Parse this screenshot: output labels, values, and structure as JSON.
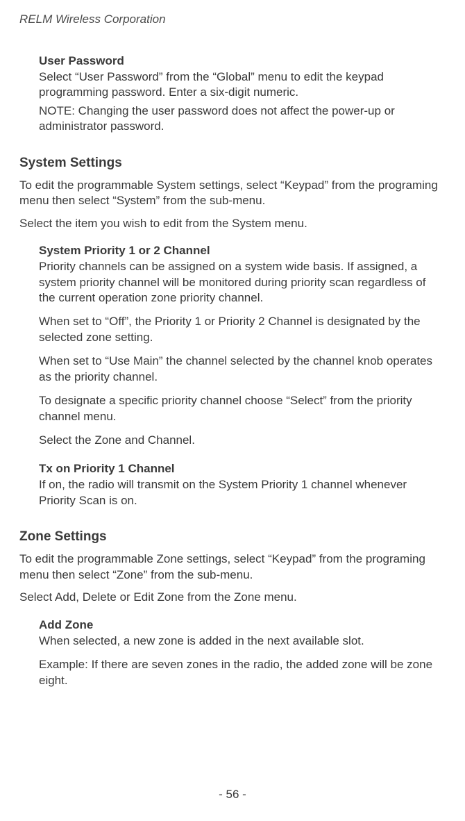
{
  "header": {
    "company": "RELM Wireless Corporation"
  },
  "user_password": {
    "heading": "User Password",
    "p1": "Select “User Password” from the “Global” menu to edit the keypad programming password. Enter a six-digit numeric.",
    "p2": "NOTE: Changing the user password does not affect the power-up or administrator password."
  },
  "system_settings": {
    "heading": "System Settings",
    "intro1": "To edit the programmable System settings, select “Keypad” from the programing menu then select “System” from the sub-menu.",
    "intro2": "Select the item you wish to edit from the System menu.",
    "priority": {
      "heading": "System Priority 1 or 2 Channel",
      "p1": "Priority channels can be assigned on a system wide basis. If assigned, a system priority channel will be monitored during priority scan regardless of the current operation zone priority channel.",
      "p2": "When set to “Off”, the Priority 1 or Priority 2 Channel is designated by the selected zone setting.",
      "p3": "When set to “Use Main” the channel selected by the channel knob operates as the priority channel.",
      "p4": "To designate a specific priority channel choose “Select” from the priority channel menu.",
      "p5": "Select the Zone and Channel."
    },
    "tx": {
      "heading": "Tx on Priority 1 Channel",
      "p1": "If on, the radio will transmit on the System Priority 1 channel whenever Priority Scan is on."
    }
  },
  "zone_settings": {
    "heading": "Zone Settings",
    "intro1": "To edit the programmable Zone settings, select “Keypad” from the programing menu then select “Zone” from the sub-menu.",
    "intro2": "Select Add, Delete or Edit Zone from the Zone menu.",
    "add_zone": {
      "heading": "Add Zone",
      "p1": "When selected, a new zone is added in the next available slot.",
      "p2": "Example: If there are seven zones in the radio, the added zone will be zone eight."
    }
  },
  "footer": {
    "page": "- 56 -"
  }
}
